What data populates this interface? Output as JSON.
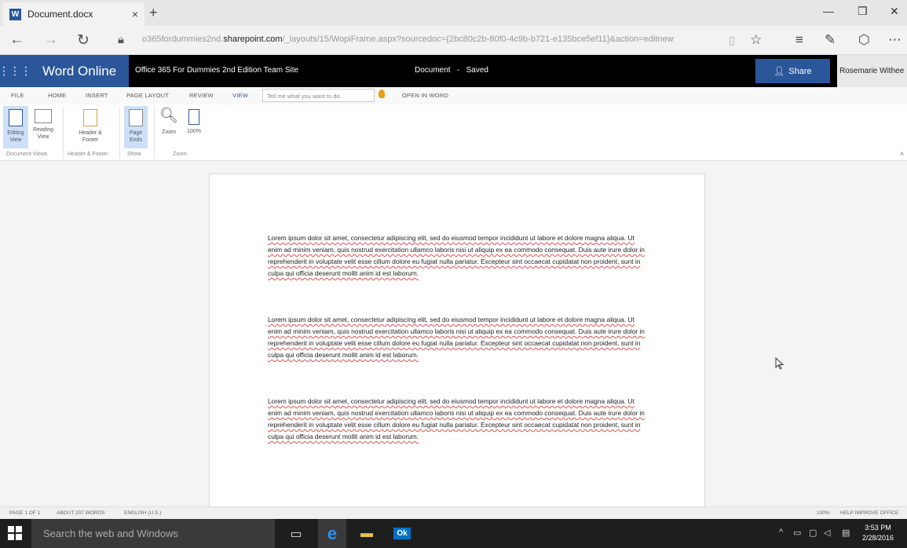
{
  "browser": {
    "tab_title": "Document.docx",
    "tab_close": "×",
    "new_tab": "+",
    "url_prefix": "o365fordummies2nd.",
    "url_domain": "sharepoint.com",
    "url_rest": "/_layouts/15/WopiFrame.aspx?sourcedoc={2bc80c2b-80f0-4c9b-b721-e135bce5ef11}&action=editnew"
  },
  "office_header": {
    "app_name": "Word Online",
    "site_name": "Office 365 For Dummies 2nd Edition Team Site",
    "doc_name": "Document",
    "doc_sep": "-",
    "doc_status": "Saved",
    "share_label": "Share",
    "user_name": "Rosemarie Withee"
  },
  "ribbon_tabs": {
    "file": "FILE",
    "home": "HOME",
    "insert": "INSERT",
    "page_layout": "PAGE LAYOUT",
    "review": "REVIEW",
    "view": "VIEW",
    "tell_me_placeholder": "Tell me what you want to do",
    "open_in_word": "OPEN IN WORD"
  },
  "ribbon": {
    "editing_view": "Editing View",
    "reading_view": "Reading View",
    "header_footer": "Header & Footer",
    "page_ends": "Page Ends",
    "zoom": "Zoom",
    "zoom_100": "100%",
    "group_document_views": "Document Views",
    "group_header_footer": "Header & Footer",
    "group_show": "Show",
    "group_zoom": "Zoom"
  },
  "document": {
    "paragraphs": [
      "Lorem ipsum dolor sit amet, consectetur adipiscing elit, sed do eiusmod tempor incididunt ut labore et dolore magna aliqua. Ut enim ad minim veniam, quis nostrud exercitation ullamco laboris nisi ut aliquip ex ea commodo consequat. Duis aute irure dolor in reprehenderit in voluptate velit esse cillum dolore eu fugiat nulla pariatur. Excepteur sint occaecat cupidatat non proident, sunt in culpa qui officia deserunt mollit anim id est laborum.",
      "Lorem ipsum dolor sit amet, consectetur adipiscing elit, sed do eiusmod tempor incididunt ut labore et dolore magna aliqua. Ut enim ad minim veniam, quis nostrud exercitation ullamco laboris nisi ut aliquip ex ea commodo consequat. Duis aute irure dolor in reprehenderit in voluptate velit esse cillum dolore eu fugiat nulla pariatur. Excepteur sint occaecat cupidatat non proident, sunt in culpa qui officia deserunt mollit anim id est laborum.",
      "Lorem ipsum dolor sit amet, consectetur adipiscing elit, sed do eiusmod tempor incididunt ut labore et dolore magna aliqua. Ut enim ad minim veniam, quis nostrud exercitation ullamco laboris nisi ut aliquip ex ea commodo consequat. Duis aute irure dolor in reprehenderit in voluptate velit esse cillum dolore eu fugiat nulla pariatur. Excepteur sint occaecat cupidatat non proident, sunt in culpa qui officia deserunt mollit anim id est laborum."
    ]
  },
  "status_bar": {
    "page": "PAGE 1 OF 1",
    "words": "ABOUT 207 WORDS",
    "language": "ENGLISH (U.S.)",
    "zoom": "100%",
    "help": "HELP IMPROVE OFFICE"
  },
  "taskbar": {
    "search_placeholder": "Search the web and Windows",
    "time": "3:53 PM",
    "date": "2/28/2016"
  },
  "colors": {
    "word_blue": "#2b579a",
    "header_black": "#000000",
    "taskbar": "#1e1e1e"
  }
}
